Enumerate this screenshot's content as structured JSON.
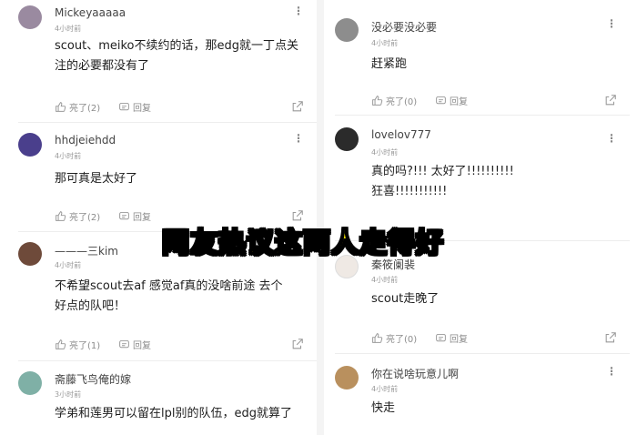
{
  "overlay_caption": "网友热议这两人走得好",
  "left_column": {
    "comments": [
      {
        "username": "Mickeyaaaaa",
        "time": "4小时前",
        "lines": [
          "scout、meiko不续约的话，那edg就一丁点关",
          "注的必要都没有了"
        ],
        "like_label": "亮了(2)",
        "reply_label": "回复",
        "avatar_color": "#9a8aa0"
      },
      {
        "username": "hhdjeiehdd",
        "time": "4小时前",
        "lines": [
          "那可真是太好了"
        ],
        "like_label": "亮了(2)",
        "reply_label": "回复",
        "avatar_color": "#4a3f8c"
      },
      {
        "username": "———三kim",
        "time": "4小时前",
        "lines": [
          "不希望scout去af 感觉af真的没啥前途 去个",
          "好点的队吧！"
        ],
        "like_label": "亮了(1)",
        "reply_label": "回复",
        "avatar_color": "#6e4a3a"
      },
      {
        "username": "斋藤飞鸟俺的嫁",
        "time": "3小时前",
        "lines": [
          "学弟和莲男可以留在lpl别的队伍，edg就算了"
        ],
        "like_label": "",
        "reply_label": "",
        "avatar_color": "#7fb0a6"
      }
    ]
  },
  "right_column": {
    "comments": [
      {
        "username": "没必要没必要",
        "time": "4小时前",
        "lines": [
          "赶紧跑"
        ],
        "like_label": "亮了(0)",
        "reply_label": "回复",
        "avatar_color": "#8d8d8d"
      },
      {
        "username": "lovelov777",
        "time": "4小时前",
        "lines": [
          "真的吗?!!! 太好了!!!!!!!!!!",
          "狂喜!!!!!!!!!!!"
        ],
        "like_label": "",
        "reply_label": "",
        "avatar_color": "#2b2b2b"
      },
      {
        "username": "秦筱阑裴",
        "time": "4小时前",
        "lines": [
          "scout走晚了"
        ],
        "like_label": "亮了(0)",
        "reply_label": "回复",
        "avatar_color": "#efe9e4"
      },
      {
        "username": "你在说啥玩意儿啊",
        "time": "4小时前",
        "lines": [
          "快走"
        ],
        "like_label": "",
        "reply_label": "",
        "avatar_color": "#b9905e"
      }
    ]
  },
  "icons": {
    "more": "more-vertical-icon",
    "like": "thumbs-up-icon",
    "reply": "reply-icon",
    "share": "share-icon"
  },
  "colors": {
    "caption_fill": "#ffeb00",
    "caption_stroke": "#000000",
    "text": "#1e1e1e",
    "muted": "#9a9a9a"
  }
}
